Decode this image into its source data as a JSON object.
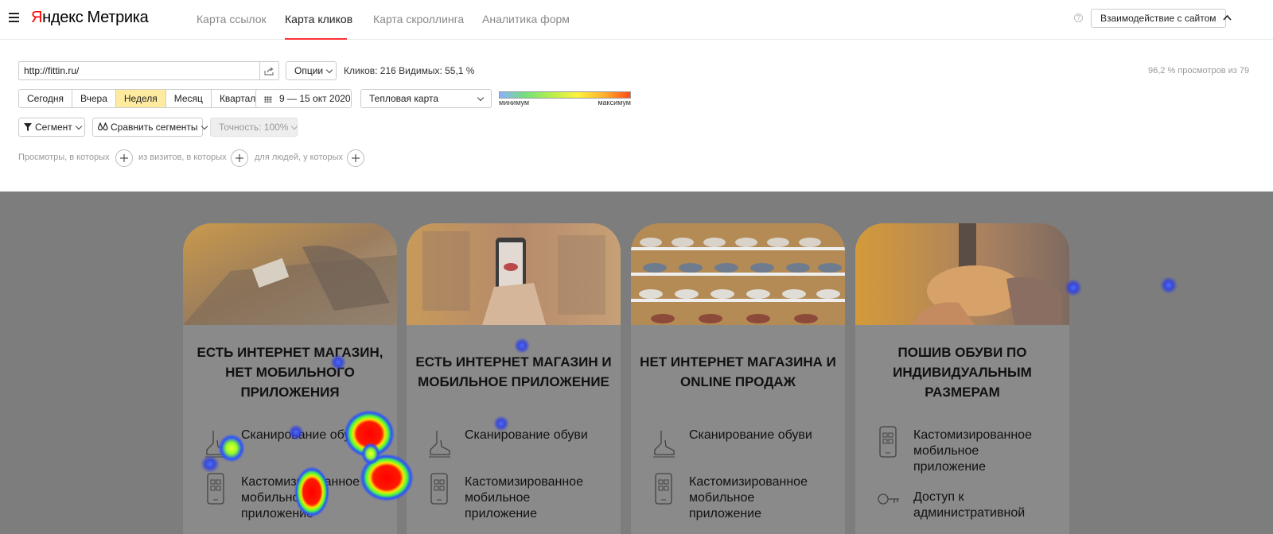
{
  "header": {
    "logo_part1": "Я",
    "logo_part2": "ндекс",
    "logo_part3": "Метрика",
    "tabs": [
      {
        "label": "Карта ссылок",
        "active": false
      },
      {
        "label": "Карта кликов",
        "active": true
      },
      {
        "label": "Карта скроллинга",
        "active": false
      },
      {
        "label": "Аналитика форм",
        "active": false
      }
    ],
    "interaction_button": "Взаимодействие с сайтом",
    "icons": [
      "menu-icon",
      "help-icon",
      "chevron-up-icon"
    ],
    "accent_color": "#ff3333"
  },
  "controls": {
    "url_value": "http://fittin.ru/",
    "options_label": "Опции",
    "stats_text": "Кликов: 216  Видимых: 55,1 %",
    "views_right": "96,2 % просмотров из 79",
    "periods": [
      {
        "label": "Сегодня",
        "active": false
      },
      {
        "label": "Вчера",
        "active": false
      },
      {
        "label": "Неделя",
        "active": true
      },
      {
        "label": "Месяц",
        "active": false
      },
      {
        "label": "Квартал",
        "active": false
      }
    ],
    "date_range": "9 — 15 окт 2020",
    "map_type": "Тепловая карта",
    "legend_min": "минимум",
    "legend_max": "максимум",
    "segment_label": "Сегмент",
    "compare_label": "Сравнить сегменты",
    "accuracy_label": "Точность: 100%",
    "filter_views": "Просмотры, в которых",
    "filter_visits": "из визитов, в которых",
    "filter_people": "для людей, у которых"
  },
  "preview": {
    "cards": [
      {
        "title_lines": [
          "ЕСТЬ ИНТЕРНЕТ МАГАЗИН,",
          "НЕТ МОБИЛЬНОГО",
          "ПРИЛОЖЕНИЯ"
        ],
        "features": [
          {
            "icon": "shoe-scan-icon",
            "text": [
              "Сканирование обуви"
            ]
          },
          {
            "icon": "mobile-app-icon",
            "text": [
              "Кастомизированное",
              "мобильное",
              "приложение"
            ]
          }
        ]
      },
      {
        "title_lines": [
          "ЕСТЬ ИНТЕРНЕТ МАГАЗИН И",
          "МОБИЛЬНОЕ ПРИЛОЖЕНИЕ"
        ],
        "features": [
          {
            "icon": "shoe-scan-icon",
            "text": [
              "Сканирование обуви"
            ]
          },
          {
            "icon": "mobile-app-icon",
            "text": [
              "Кастомизированное",
              "мобильное",
              "приложение"
            ]
          }
        ]
      },
      {
        "title_lines": [
          "НЕТ ИНТЕРНЕТ МАГАЗИНА И",
          "ONLINE ПРОДАЖ"
        ],
        "features": [
          {
            "icon": "shoe-scan-icon",
            "text": [
              "Сканирование обуви"
            ]
          },
          {
            "icon": "mobile-app-icon",
            "text": [
              "Кастомизированное",
              "мобильное",
              "приложение"
            ]
          }
        ]
      },
      {
        "title_lines": [
          "ПОШИВ ОБУВИ ПО",
          "ИНДИВИДУАЛЬНЫМ",
          "РАЗМЕРАМ"
        ],
        "features": [
          {
            "icon": "mobile-app-icon",
            "text": [
              "Кастомизированное",
              "мобильное",
              "приложение"
            ]
          },
          {
            "icon": "admin-key-icon",
            "text": [
              "Доступ к",
              "административной"
            ]
          }
        ]
      }
    ]
  }
}
